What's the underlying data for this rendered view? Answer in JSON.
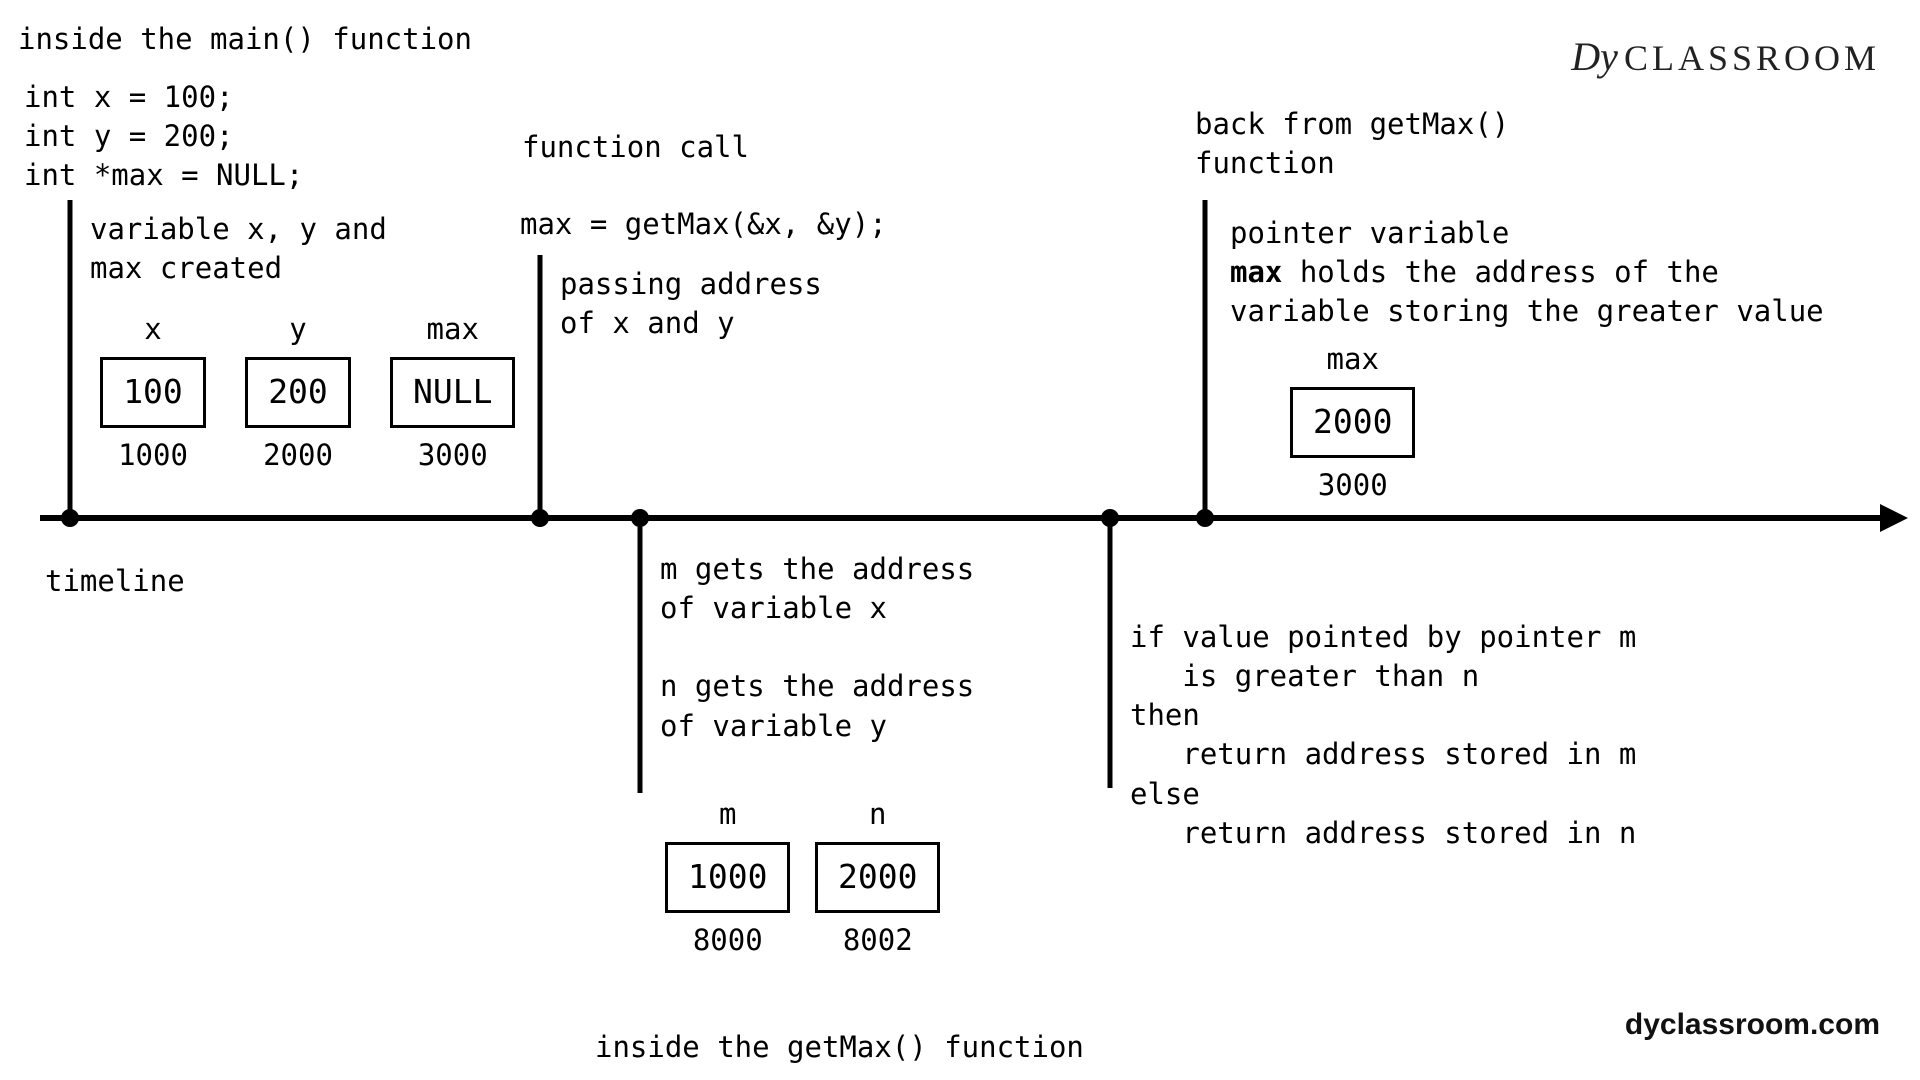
{
  "logo": "CLASSROOM",
  "footer_url": "dyclassroom.com",
  "heading_main": "inside the main() function",
  "heading_getmax": "inside the getMax() function",
  "timeline_label": "timeline",
  "code": {
    "l1": "int x = 100;",
    "l2": "int y = 200;",
    "l3": "int *max = NULL;"
  },
  "step1": {
    "title": "variable x, y and\nmax created",
    "vars": [
      {
        "name": "x",
        "value": "100",
        "addr": "1000"
      },
      {
        "name": "y",
        "value": "200",
        "addr": "2000"
      },
      {
        "name": "max",
        "value": "NULL",
        "addr": "3000"
      }
    ]
  },
  "step2": {
    "title": "function call",
    "call": "max = getMax(&x, &y);",
    "desc": "passing address\nof x and y"
  },
  "branch_mn": {
    "desc": "m gets the address\nof variable x\n\nn gets the address\nof variable y",
    "vars": [
      {
        "name": "m",
        "value": "1000",
        "addr": "8000"
      },
      {
        "name": "n",
        "value": "2000",
        "addr": "8002"
      }
    ]
  },
  "branch_if": {
    "text": "if value pointed by pointer m\n   is greater than n\nthen\n   return address stored in m\nelse\n   return address stored in n"
  },
  "step3": {
    "title": "back from getMax()\nfunction",
    "desc_pre": "pointer variable",
    "desc_bold": "max",
    "desc_post1": " holds the address of the",
    "desc_post2": "variable storing the greater value",
    "var": {
      "name": "max",
      "value": "2000",
      "addr": "3000"
    }
  }
}
